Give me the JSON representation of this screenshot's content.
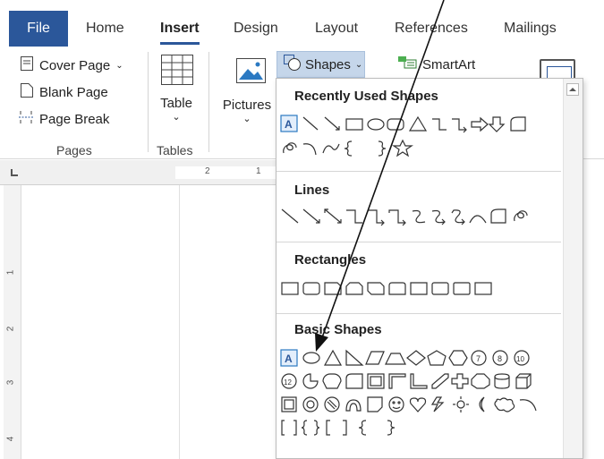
{
  "tabs": {
    "file": "File",
    "home": "Home",
    "insert": "Insert",
    "design": "Design",
    "layout": "Layout",
    "references": "References",
    "mailings": "Mailings"
  },
  "ribbon": {
    "pages": {
      "cover_page": "Cover Page",
      "blank_page": "Blank Page",
      "page_break": "Page Break",
      "label": "Pages"
    },
    "tables": {
      "table": "Table",
      "label": "Tables"
    },
    "illustrations": {
      "pictures": "Pictures",
      "shapes": "Shapes",
      "smartart": "SmartArt"
    }
  },
  "ruler": {
    "h_marks": [
      "2",
      "1"
    ],
    "v_marks": [
      "1",
      "2",
      "3",
      "4"
    ]
  },
  "gallery": {
    "recently_used": "Recently Used Shapes",
    "lines": "Lines",
    "rectangles": "Rectangles",
    "basic_shapes": "Basic Shapes"
  },
  "colors": {
    "accent": "#2b579a",
    "shapes_button_bg": "#c5d6ea",
    "stroke": "#333333"
  }
}
